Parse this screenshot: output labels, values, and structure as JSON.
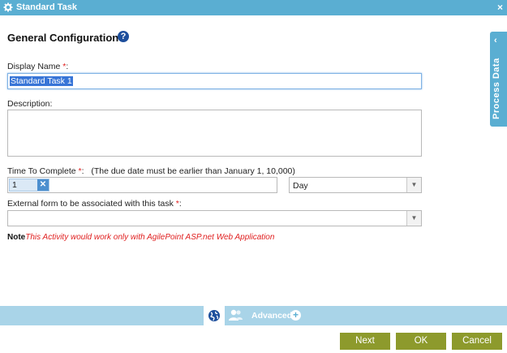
{
  "window": {
    "title": "Standard Task",
    "close_label": "×"
  },
  "section": {
    "title": "General Configuration",
    "help_label": "?"
  },
  "display_name": {
    "label": "Display Name",
    "required_mark": "*",
    "colon": ":",
    "value": "Standard Task 1"
  },
  "description": {
    "label": "Description:",
    "value": ""
  },
  "time_to_complete": {
    "label": "Time To Complete",
    "required_mark": "*",
    "colon": ":",
    "hint": "(The due date must be earlier than January 1, 10,000)",
    "value": "1",
    "clear_label": "✕",
    "unit": "Day"
  },
  "external_form": {
    "label": "External form to be associated with this task",
    "required_mark": "*",
    "colon": ":",
    "value": ""
  },
  "note": {
    "label": "Note",
    "text": "This Activity would work only with AgilePoint ASP.net Web Application"
  },
  "side_tab": {
    "label": "Process Data",
    "chevron": "‹"
  },
  "bottom_tabs": {
    "advanced_label": "Advanced",
    "advanced_plus": "+"
  },
  "buttons": {
    "next": "Next",
    "ok": "OK",
    "cancel": "Cancel"
  },
  "colors": {
    "header": "#5aaed2",
    "bottom_bar": "#a9d4e8",
    "button": "#8d9a2c",
    "required": "#e02020",
    "help": "#1e4f9c"
  },
  "icons": {
    "header": "gear-icon",
    "help": "question-circle-icon",
    "globe": "globe-icon",
    "users": "users-icon",
    "plus": "plus-circle-icon"
  }
}
